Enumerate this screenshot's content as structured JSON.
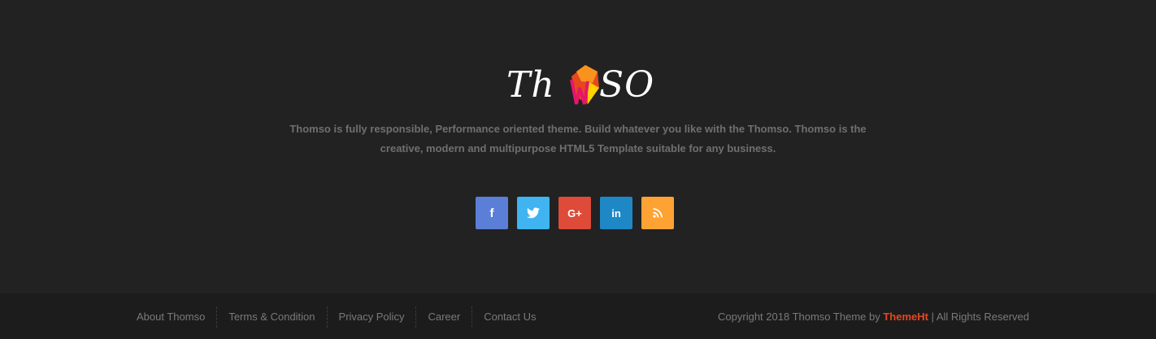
{
  "logo": {
    "text_left": "Th",
    "text_right": "SO",
    "mark_colors": [
      "#f7931e",
      "#e5471f",
      "#ffd200",
      "#e6156b"
    ]
  },
  "footer": {
    "description": "Thomso is fully responsible, Performance oriented theme. Build whatever you like with the Thomso. Thomso is the creative, modern and multipurpose HTML5 Template suitable for any business.",
    "social": [
      {
        "name": "facebook-icon",
        "glyph": "f",
        "color": "#5b7fd6"
      },
      {
        "name": "twitter-icon",
        "glyph": "🐦",
        "color": "#3fb4f0"
      },
      {
        "name": "google-plus-icon",
        "glyph": "G+",
        "color": "#de4b39"
      },
      {
        "name": "linkedin-icon",
        "glyph": "in",
        "color": "#1e88c7"
      },
      {
        "name": "rss-icon",
        "glyph": "◔",
        "color": "#ffa234"
      }
    ]
  },
  "bottom": {
    "nav": [
      "About Thomso",
      "Terms & Condition",
      "Privacy Policy",
      "Career",
      "Contact Us"
    ],
    "copyright_prefix": "Copyright 2018 Thomso Theme by ",
    "copyright_brand": "ThemeHt",
    "copyright_suffix": " | All Rights Reserved",
    "brand_color": "#e5471f"
  }
}
